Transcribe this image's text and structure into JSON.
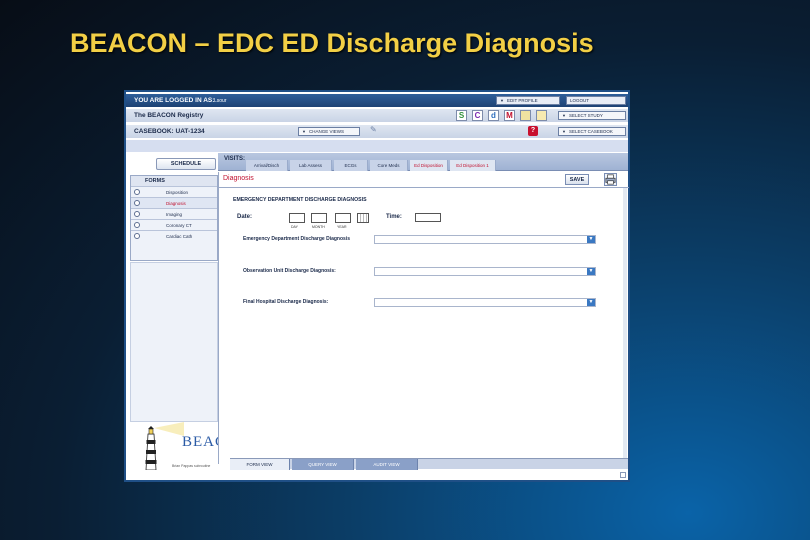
{
  "slide": {
    "title": "BEACON – EDC ED Discharge Diagnosis"
  },
  "header": {
    "logged_in_label": "YOU ARE LOGGED IN AS:",
    "logged_in_user": "Lsour",
    "registry": "The BEACON Registry",
    "casebook_label": "CASEBOOK: UAT-1234",
    "edit_profile": "EDIT PROFILE",
    "logout": "LOGOUT",
    "select_study": "SELECT STUDY",
    "select_casebook": "SELECT CASEBOOK",
    "change_view": "CHANGE VIEWS"
  },
  "tools": {
    "s_icon": "S",
    "c_icon": "C",
    "d_icon": "d",
    "m_icon": "M"
  },
  "nav": {
    "schedule": "SCHEDULE",
    "visits_label": "VISITS:",
    "visits": [
      {
        "label": "Arrival/Disch"
      },
      {
        "label": "Lab Assess"
      },
      {
        "label": "ECGs"
      },
      {
        "label": "Core Meds"
      },
      {
        "label": "Ed Disposition"
      },
      {
        "label": "Ed Disposition 1"
      }
    ]
  },
  "forms": {
    "header": "FORMS",
    "items": [
      {
        "label": "Disposition"
      },
      {
        "label": "Diagnosis"
      },
      {
        "label": "Imaging"
      },
      {
        "label": "Coronary CT"
      },
      {
        "label": "Cardiac Cath"
      }
    ]
  },
  "logo": {
    "text": "BEAC",
    "sub": "Brian Pappas subroutine"
  },
  "form": {
    "title": "Diagnosis",
    "save": "SAVE",
    "section": "EMERGENCY DEPARTMENT DISCHARGE DIAGNOSIS",
    "date_label": "Date:",
    "day": "DAY",
    "month": "MONTH",
    "year": "YEAR",
    "time_label": "Time:",
    "fields": [
      {
        "label": "Emergency Department Discharge Diagnosis"
      },
      {
        "label": "Observation Unit Discharge Diagnosis:"
      },
      {
        "label": "Final Hospital Discharge Diagnosis:"
      }
    ]
  },
  "views": {
    "form": "FORM VIEW",
    "query": "QUERY VIEW",
    "audit": "AUDIT VIEW"
  }
}
